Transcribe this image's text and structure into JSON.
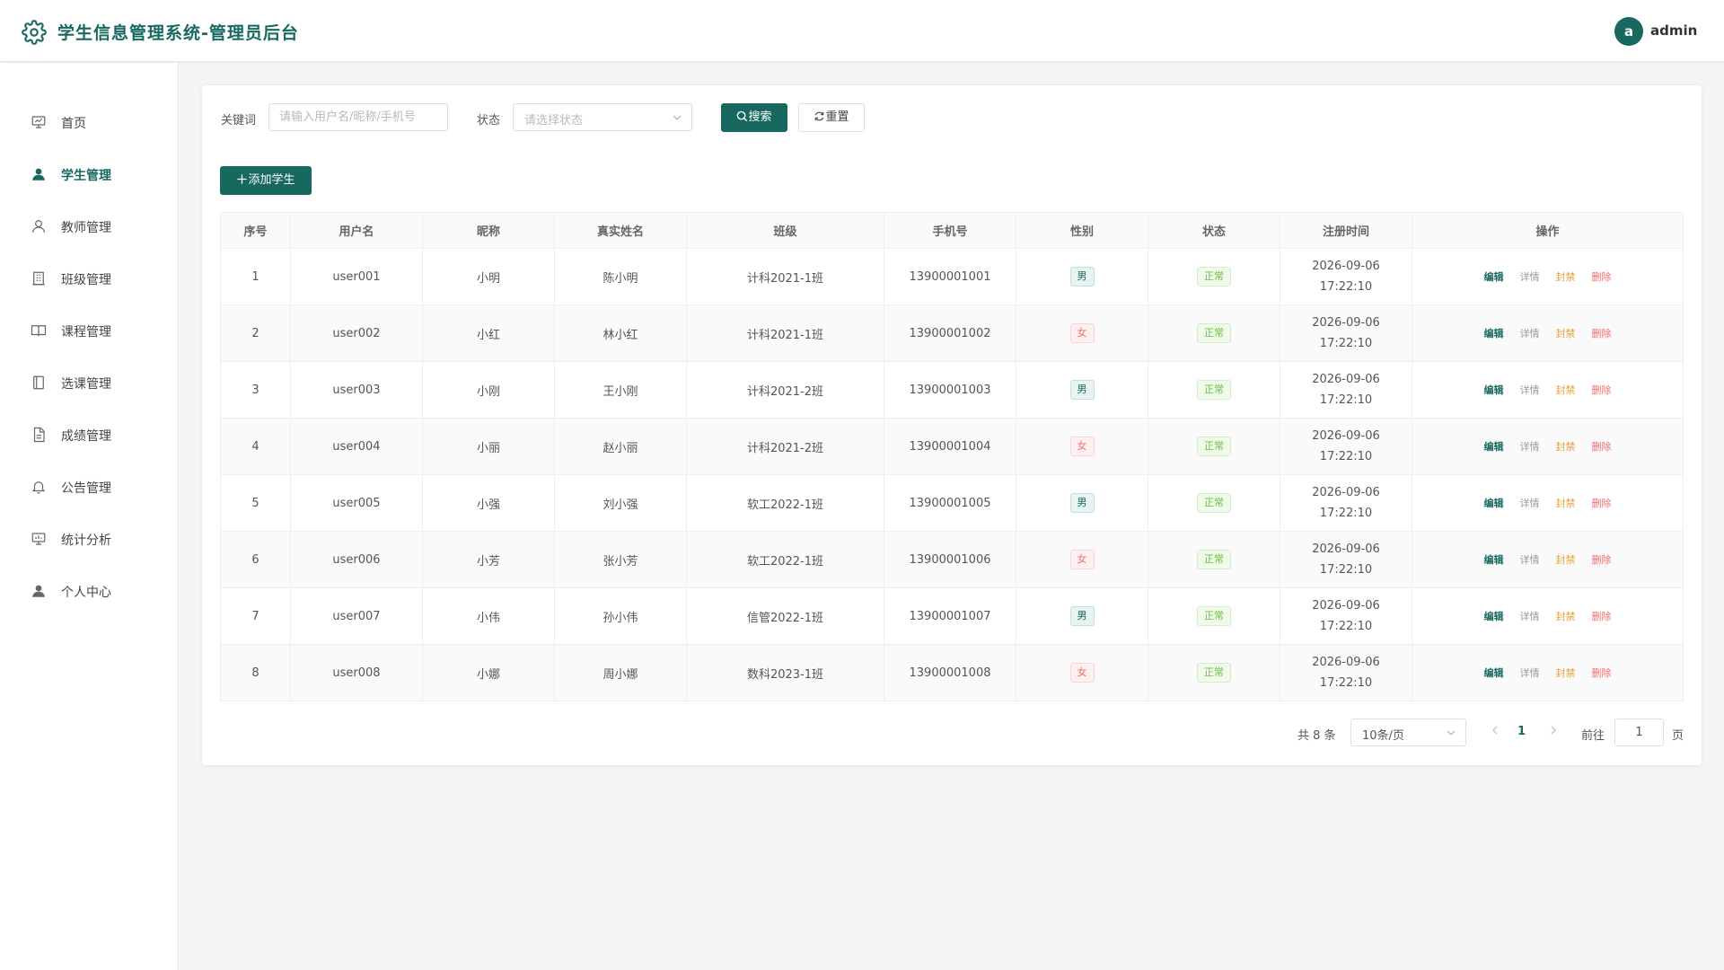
{
  "header": {
    "title": "学生信息管理系统-管理员后台",
    "avatar_letter": "a",
    "username": "admin"
  },
  "sidebar": {
    "items": [
      {
        "label": "首页",
        "icon": "dashboard-icon"
      },
      {
        "label": "学生管理",
        "icon": "user-icon",
        "active": true
      },
      {
        "label": "教师管理",
        "icon": "user-outline-icon"
      },
      {
        "label": "班级管理",
        "icon": "building-icon"
      },
      {
        "label": "课程管理",
        "icon": "book-icon"
      },
      {
        "label": "选课管理",
        "icon": "notebook-icon"
      },
      {
        "label": "成绩管理",
        "icon": "document-icon"
      },
      {
        "label": "公告管理",
        "icon": "bell-icon"
      },
      {
        "label": "统计分析",
        "icon": "chart-icon"
      },
      {
        "label": "个人中心",
        "icon": "user-icon"
      }
    ]
  },
  "filters": {
    "keyword_label": "关键词",
    "keyword_placeholder": "请输入用户名/昵称/手机号",
    "status_label": "状态",
    "status_placeholder": "请选择状态",
    "search_label": "搜索",
    "reset_label": "重置"
  },
  "toolbar": {
    "add_label": "添加学生"
  },
  "table": {
    "headers": [
      "序号",
      "用户名",
      "昵称",
      "真实姓名",
      "班级",
      "手机号",
      "性别",
      "状态",
      "注册时间",
      "操作"
    ],
    "rows": [
      {
        "no": "1",
        "username": "user001",
        "nickname": "小明",
        "realname": "陈小明",
        "class": "计科2021-1班",
        "phone": "13900001001",
        "gender": "男",
        "status": "正常",
        "date": "2026-09-06",
        "time": "17:22:10"
      },
      {
        "no": "2",
        "username": "user002",
        "nickname": "小红",
        "realname": "林小红",
        "class": "计科2021-1班",
        "phone": "13900001002",
        "gender": "女",
        "status": "正常",
        "date": "2026-09-06",
        "time": "17:22:10"
      },
      {
        "no": "3",
        "username": "user003",
        "nickname": "小刚",
        "realname": "王小刚",
        "class": "计科2021-2班",
        "phone": "13900001003",
        "gender": "男",
        "status": "正常",
        "date": "2026-09-06",
        "time": "17:22:10"
      },
      {
        "no": "4",
        "username": "user004",
        "nickname": "小丽",
        "realname": "赵小丽",
        "class": "计科2021-2班",
        "phone": "13900001004",
        "gender": "女",
        "status": "正常",
        "date": "2026-09-06",
        "time": "17:22:10"
      },
      {
        "no": "5",
        "username": "user005",
        "nickname": "小强",
        "realname": "刘小强",
        "class": "软工2022-1班",
        "phone": "13900001005",
        "gender": "男",
        "status": "正常",
        "date": "2026-09-06",
        "time": "17:22:10"
      },
      {
        "no": "6",
        "username": "user006",
        "nickname": "小芳",
        "realname": "张小芳",
        "class": "软工2022-1班",
        "phone": "13900001006",
        "gender": "女",
        "status": "正常",
        "date": "2026-09-06",
        "time": "17:22:10"
      },
      {
        "no": "7",
        "username": "user007",
        "nickname": "小伟",
        "realname": "孙小伟",
        "class": "信管2022-1班",
        "phone": "13900001007",
        "gender": "男",
        "status": "正常",
        "date": "2026-09-06",
        "time": "17:22:10"
      },
      {
        "no": "8",
        "username": "user008",
        "nickname": "小娜",
        "realname": "周小娜",
        "class": "数科2023-1班",
        "phone": "13900001008",
        "gender": "女",
        "status": "正常",
        "date": "2026-09-06",
        "time": "17:22:10"
      }
    ],
    "actions": {
      "edit": "编辑",
      "detail": "详情",
      "ban": "封禁",
      "delete": "删除"
    }
  },
  "pagination": {
    "total_text": "共 8 条",
    "page_size": "10条/页",
    "current_page": "1",
    "goto_label": "前往",
    "goto_value": "1",
    "page_suffix": "页"
  },
  "colors": {
    "primary": "#17695f",
    "male_tag": "#17695f",
    "female_tag": "#f56c6c",
    "status_ok": "#67c23a",
    "ban": "#e6a23c",
    "delete": "#f56c6c"
  }
}
